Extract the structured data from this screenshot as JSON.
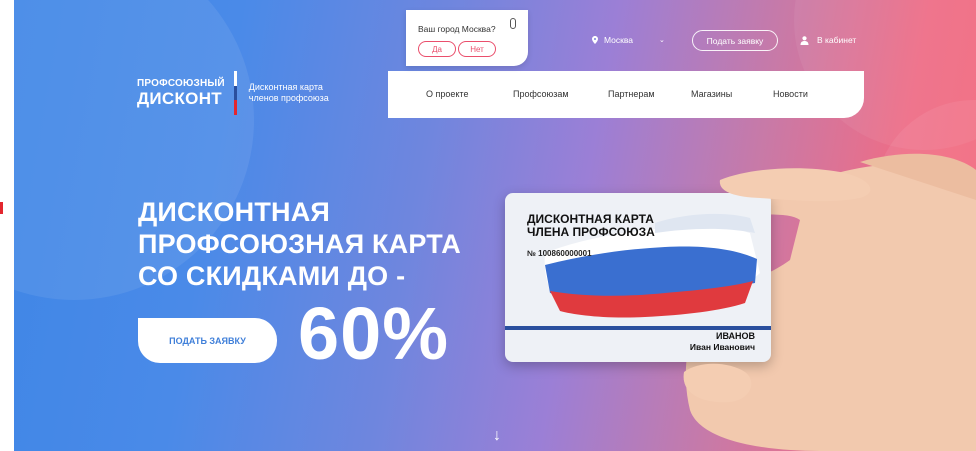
{
  "city_popup": {
    "question": "Ваш город Москва?",
    "yes": "Да",
    "no": "Нет"
  },
  "topbar": {
    "city": "Москва",
    "apply": "Подать заявку",
    "cabinet": "В кабинет"
  },
  "logo": {
    "line1": "ПРОФСОЮЗНЫЙ",
    "line2": "ДИСКОНТ",
    "tagline1": "Дисконтная карта",
    "tagline2": "членов профсоюза"
  },
  "nav": {
    "items": [
      "О проекте",
      "Профсоюзам",
      "Партнерам",
      "Магазины",
      "Новости"
    ]
  },
  "hero": {
    "headline1": "ДИСКОНТНАЯ",
    "headline2": "ПРОФСОЮЗНАЯ КАРТА",
    "headline3": "СО СКИДКАМИ ДО -",
    "apply_button": "ПОДАТЬ ЗАЯВКУ",
    "percent": "60%",
    "scroll_arrow": "↓"
  },
  "card": {
    "title1": "ДИСКОНТНАЯ КАРТА",
    "title2": "ЧЛЕНА ПРОФСОЮЗА",
    "number": "№ 100860000001",
    "surname": "ИВАНОВ",
    "name": "Иван Иванович"
  },
  "colors": {
    "accent_pink": "#ea4f6c",
    "brand_blue": "#3f7fd9",
    "flag_blue": "#2a4f9e",
    "flag_red": "#e3262e"
  }
}
